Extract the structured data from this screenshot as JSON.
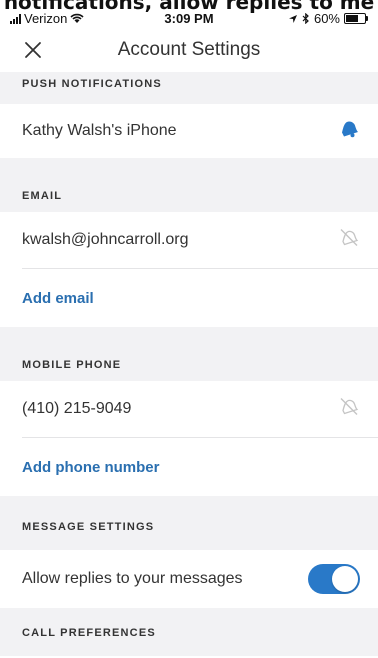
{
  "caption": "notifications, allow replies to me",
  "status_bar": {
    "carrier": "Verizon",
    "time": "3:09 PM",
    "battery": "60%"
  },
  "navbar": {
    "title": "Account Settings"
  },
  "sections": {
    "push": {
      "header": "PUSH NOTIFICATIONS",
      "device": "Kathy Walsh's iPhone"
    },
    "email": {
      "header": "EMAIL",
      "address": "kwalsh@johncarroll.org",
      "add_label": "Add email"
    },
    "mobile": {
      "header": "MOBILE PHONE",
      "number": "(410) 215-9049",
      "add_label": "Add phone number"
    },
    "message": {
      "header": "MESSAGE SETTINGS",
      "allow_replies_label": "Allow replies to your messages",
      "allow_replies_on": true
    },
    "call": {
      "header": "CALL PREFERENCES"
    }
  },
  "colors": {
    "accent": "#2979c8",
    "link": "#2a6fb0",
    "section_bg": "#f2f2f4"
  }
}
